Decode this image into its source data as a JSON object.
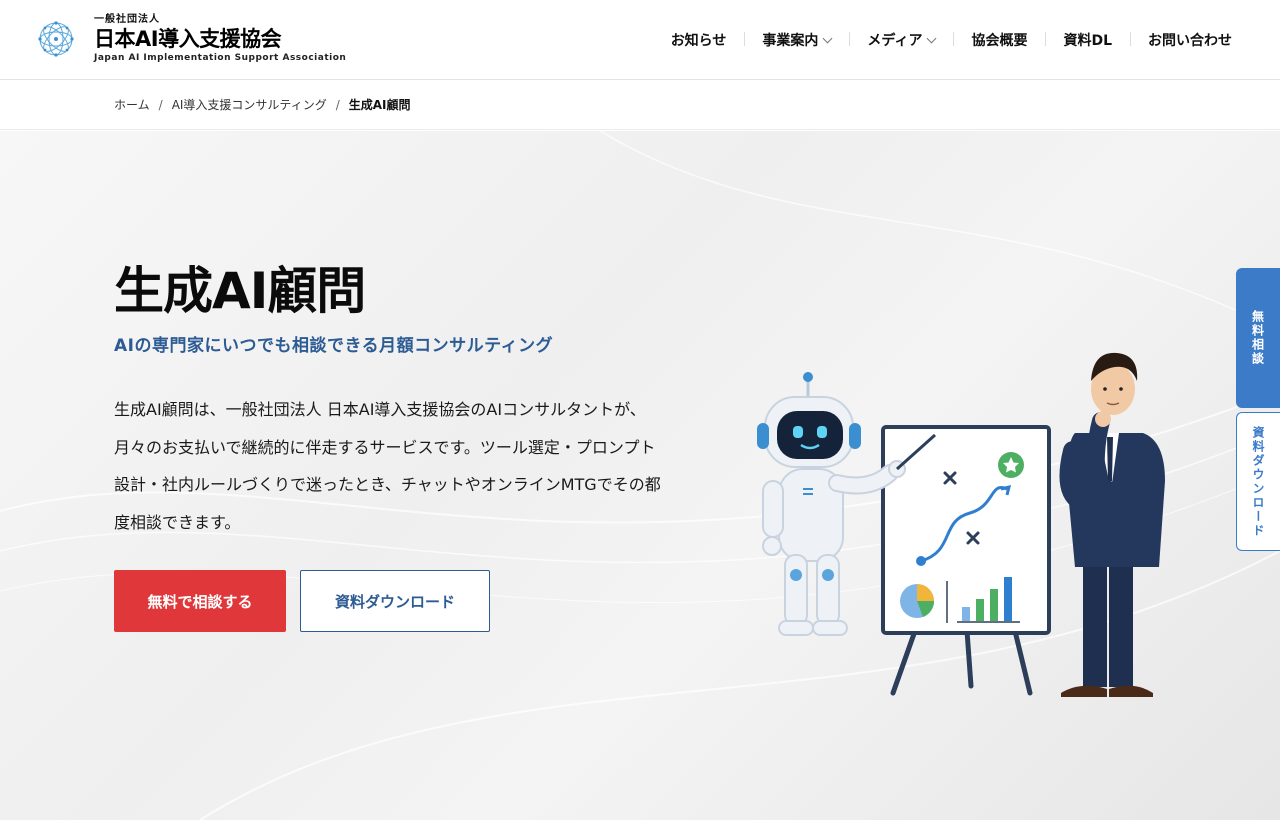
{
  "logo": {
    "sub": "一般社団法人",
    "main": "日本AI導入支援協会",
    "en": "Japan AI Implementation Support Association",
    "icon": "network-globe-icon"
  },
  "nav": {
    "items": [
      {
        "label": "お知らせ",
        "dropdown": false
      },
      {
        "label": "事業案内",
        "dropdown": true
      },
      {
        "label": "メディア",
        "dropdown": true
      },
      {
        "label": "協会概要",
        "dropdown": false
      },
      {
        "label": "資料DL",
        "dropdown": false
      },
      {
        "label": "お問い合わせ",
        "dropdown": false
      }
    ]
  },
  "breadcrumb": {
    "home": "ホーム",
    "parent": "AI導入支援コンサルティング",
    "current": "生成AI顧問",
    "separator": "/"
  },
  "hero": {
    "title": "生成AI顧問",
    "subtitle": "AIの専門家にいつでも相談できる月額コンサルティング",
    "description_lines": [
      "生成AI顧問は、一般社団法人 日本AI導入支援協会のAIコンサルタントが、",
      "月々のお支払いで継続的に伴走するサービスです。ツール選定・プロンプト",
      "設計・社内ルールづくりで迷ったとき、チャットやオンラインMTGでその都",
      "度相談できます。"
    ],
    "primary_button": "無料で相談する",
    "secondary_button": "資料ダウンロード",
    "illustration": "robot-presenting-whiteboard-with-businessman"
  },
  "side_tabs": {
    "consult": "無料相談",
    "document": "資料ダウンロード"
  },
  "colors": {
    "accent_red": "#e0383a",
    "accent_blue": "#2d5b93",
    "side_blue": "#3b7bc8"
  }
}
